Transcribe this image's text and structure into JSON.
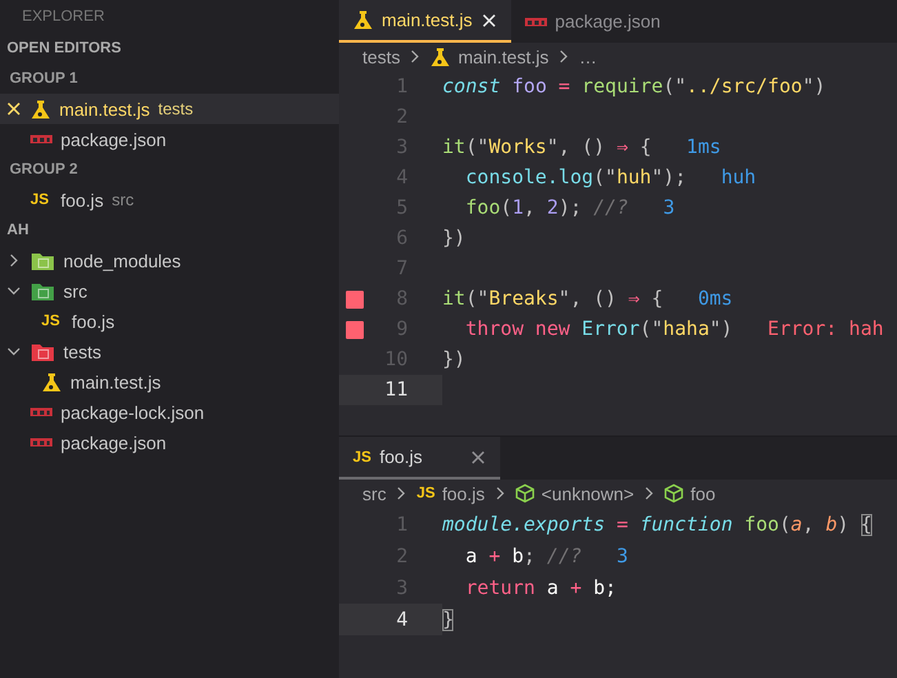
{
  "sidebar": {
    "title": "EXPLORER",
    "open_editors": {
      "title": "OPEN EDITORS",
      "groups": [
        {
          "title": "GROUP 1",
          "items": [
            {
              "label": "main.test.js",
              "description": "tests",
              "kind": "test",
              "selected": true
            },
            {
              "label": "package.json",
              "kind": "npm",
              "selected": false
            }
          ]
        },
        {
          "title": "GROUP 2",
          "items": [
            {
              "label": "foo.js",
              "description": "src",
              "kind": "js",
              "badge": "JS",
              "selected": false
            }
          ]
        }
      ]
    },
    "folder": {
      "title": "AH",
      "items": [
        {
          "label": "node_modules",
          "kind": "folder",
          "color": "#8bc34a",
          "expanded": false
        },
        {
          "label": "src",
          "kind": "folder",
          "color": "#43a047",
          "expanded": true,
          "children": [
            {
              "label": "foo.js",
              "kind": "js",
              "badge": "JS"
            }
          ]
        },
        {
          "label": "tests",
          "kind": "folder",
          "color": "#e53945",
          "expanded": true,
          "children": [
            {
              "label": "main.test.js",
              "kind": "test"
            }
          ]
        },
        {
          "label": "package-lock.json",
          "kind": "npm"
        },
        {
          "label": "package.json",
          "kind": "npm"
        }
      ]
    }
  },
  "editor_groups": [
    {
      "focused": true,
      "tabs": [
        {
          "label": "main.test.js",
          "kind": "test",
          "selected": true
        },
        {
          "label": "package.json",
          "kind": "npm",
          "selected": false
        }
      ],
      "breadcrumb": [
        {
          "kind": "folder",
          "text": "tests"
        },
        {
          "kind": "test",
          "text": "main.test.js"
        },
        {
          "kind": "more",
          "text": "…"
        }
      ],
      "lines": [
        {
          "number": "1",
          "error": false,
          "current": false,
          "tokens": [
            {
              "kind": "kw",
              "text": "const"
            },
            {
              "kind": "var",
              "text": " foo"
            },
            {
              "kind": "op",
              "text": " = "
            },
            {
              "kind": "fn",
              "text": "require"
            },
            {
              "kind": "punct",
              "text": "(\""
            },
            {
              "kind": "str",
              "text": "../src/foo"
            },
            {
              "kind": "punct",
              "text": "\")"
            }
          ]
        },
        {
          "number": "2",
          "error": false,
          "current": false
        },
        {
          "number": "3",
          "error": false,
          "current": false,
          "tokens": [
            {
              "kind": "fn",
              "text": "it"
            },
            {
              "kind": "punct",
              "text": "(\""
            },
            {
              "kind": "str",
              "text": "Works"
            },
            {
              "kind": "punct",
              "text": "\", () "
            },
            {
              "kind": "op",
              "text": "⇒"
            },
            {
              "kind": "punct",
              "text": " {"
            }
          ],
          "annotation": {
            "kind": "value",
            "text": "1ms"
          }
        },
        {
          "number": "4",
          "error": false,
          "current": false,
          "tokens": [
            {
              "kind": "member",
              "text": "  console.log"
            },
            {
              "kind": "punct",
              "text": "(\""
            },
            {
              "kind": "str",
              "text": "huh"
            },
            {
              "kind": "punct",
              "text": "\");"
            }
          ],
          "annotation": {
            "kind": "value",
            "text": "huh"
          }
        },
        {
          "number": "5",
          "error": false,
          "current": false,
          "tokens": [
            {
              "kind": "fn",
              "text": "  foo"
            },
            {
              "kind": "punct",
              "text": "("
            },
            {
              "kind": "num",
              "text": "1"
            },
            {
              "kind": "punct",
              "text": ", "
            },
            {
              "kind": "num",
              "text": "2"
            },
            {
              "kind": "punct",
              "text": "); "
            },
            {
              "kind": "cmt",
              "text": "//?"
            }
          ],
          "annotation": {
            "kind": "value",
            "text": "3"
          }
        },
        {
          "number": "6",
          "error": false,
          "current": false,
          "tokens": [
            {
              "kind": "punct",
              "text": "})"
            }
          ]
        },
        {
          "number": "7",
          "error": false,
          "current": false
        },
        {
          "number": "8",
          "error": true,
          "current": false,
          "tokens": [
            {
              "kind": "fn",
              "text": "it"
            },
            {
              "kind": "punct",
              "text": "(\""
            },
            {
              "kind": "str",
              "text": "Breaks"
            },
            {
              "kind": "punct",
              "text": "\", () "
            },
            {
              "kind": "op",
              "text": "⇒"
            },
            {
              "kind": "punct",
              "text": " {"
            }
          ],
          "annotation": {
            "kind": "value",
            "text": "0ms"
          }
        },
        {
          "number": "9",
          "error": true,
          "current": false,
          "tokens": [
            {
              "kind": "ctl",
              "text": "  throw new"
            },
            {
              "kind": "cls",
              "text": " Error"
            },
            {
              "kind": "punct",
              "text": "(\""
            },
            {
              "kind": "str",
              "text": "haha"
            },
            {
              "kind": "punct",
              "text": "\")"
            }
          ],
          "annotation": {
            "kind": "error",
            "text": "Error: hah"
          }
        },
        {
          "number": "10",
          "error": false,
          "current": false,
          "tokens": [
            {
              "kind": "punct",
              "text": "})"
            }
          ]
        },
        {
          "number": "11",
          "error": false,
          "current": true
        }
      ]
    },
    {
      "focused": false,
      "tabs": [
        {
          "label": "foo.js",
          "kind": "js",
          "badge": "JS",
          "selected": true
        }
      ],
      "breadcrumb": [
        {
          "kind": "folder",
          "text": "src"
        },
        {
          "kind": "js",
          "badge": "JS",
          "text": "foo.js"
        },
        {
          "kind": "symbol",
          "text": "<unknown>"
        },
        {
          "kind": "symbol",
          "text": "foo"
        }
      ],
      "lines": [
        {
          "number": "1",
          "error": false,
          "current": false,
          "tokens": [
            {
              "kind": "kw",
              "text": "module.exports"
            },
            {
              "kind": "op",
              "text": " = "
            },
            {
              "kind": "kw",
              "text": "function"
            },
            {
              "kind": "fn",
              "text": " foo"
            },
            {
              "kind": "punct",
              "text": "("
            },
            {
              "kind": "param",
              "text": "a"
            },
            {
              "kind": "punct",
              "text": ", "
            },
            {
              "kind": "param",
              "text": "b"
            },
            {
              "kind": "punct",
              "text": ") "
            },
            {
              "kind": "match",
              "text": "{"
            }
          ]
        },
        {
          "number": "2",
          "error": false,
          "current": false,
          "tokens": [
            {
              "kind": "plain",
              "text": "  a"
            },
            {
              "kind": "op",
              "text": " + "
            },
            {
              "kind": "plain",
              "text": "b"
            },
            {
              "kind": "punct",
              "text": "; "
            },
            {
              "kind": "cmt",
              "text": "//?"
            }
          ],
          "annotation": {
            "kind": "value",
            "text": "3"
          }
        },
        {
          "number": "3",
          "error": false,
          "current": false,
          "tokens": [
            {
              "kind": "ctl",
              "text": "  return"
            },
            {
              "kind": "plain",
              "text": " a"
            },
            {
              "kind": "op",
              "text": " + "
            },
            {
              "kind": "plain",
              "text": "b;"
            }
          ]
        },
        {
          "number": "4",
          "error": false,
          "current": true,
          "tokens": [
            {
              "kind": "match",
              "text": "}"
            }
          ]
        }
      ]
    }
  ]
}
